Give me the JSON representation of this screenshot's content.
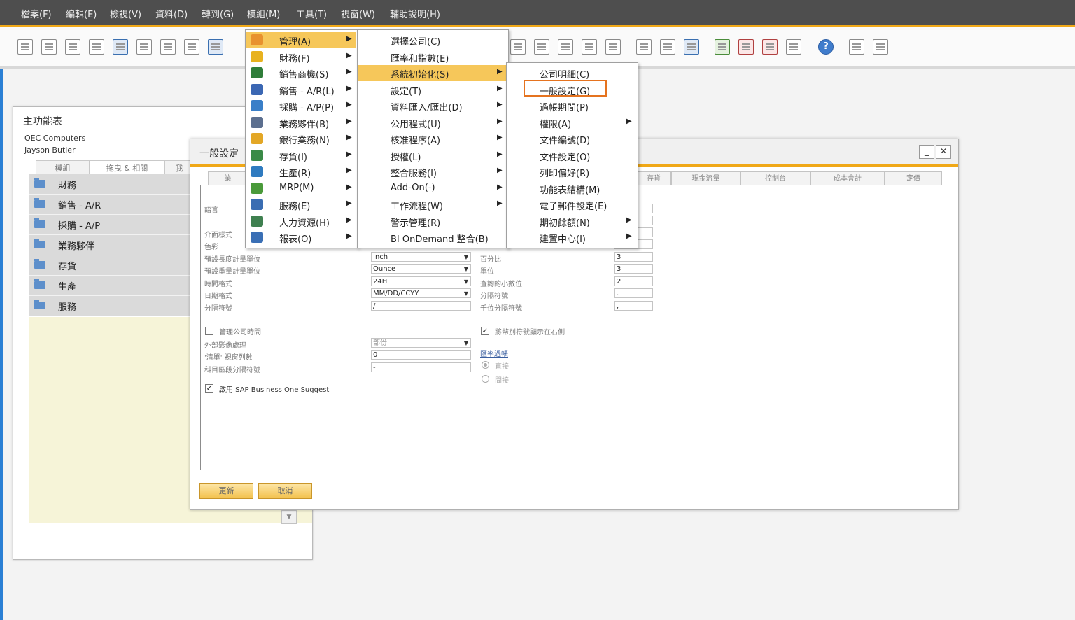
{
  "menubar": [
    "檔案(F)",
    "編輯(E)",
    "檢視(V)",
    "資料(D)",
    "轉到(G)",
    "模組(M)",
    "工具(T)",
    "視窗(W)",
    "輔助說明(H)"
  ],
  "toolbar": {
    "icons": [
      "preview-icon",
      "print-icon",
      "email-icon",
      "fax-icon",
      "sms-icon",
      "export-excel-icon",
      "export-word-icon",
      "export-pdf-icon",
      "move-icon",
      "help-icon"
    ],
    "help_label": "?"
  },
  "main_menu": {
    "title": "主功能表",
    "company": "OEC Computers",
    "user": "Jayson Butler",
    "tabs": [
      "模組",
      "拖曳 & 相關",
      "我"
    ],
    "items": [
      "財務",
      "銷售 - A/R",
      "採購 - A/P",
      "業務夥伴",
      "存貨",
      "生產",
      "服務"
    ],
    "scroll_glyph": "▼"
  },
  "general_settings": {
    "title": "一般設定",
    "minimize": "_",
    "close": "✕",
    "tabs_left": [
      "業"
    ],
    "tabs_right": [
      "存貨",
      "現金流量",
      "控制台",
      "成本會計",
      "定價"
    ],
    "left_fields": [
      {
        "label": "語言",
        "value": ""
      },
      {
        "label": "介面樣式",
        "value": ""
      },
      {
        "label": "色彩",
        "value": ""
      },
      {
        "label": "預設長度計量單位",
        "value": "Inch"
      },
      {
        "label": "預設重量計量單位",
        "value": "Ounce"
      },
      {
        "label": "時間格式",
        "value": "24H"
      },
      {
        "label": "日期格式",
        "value": "MM/DD/CCYY"
      },
      {
        "label": "分隔符號",
        "value": "/"
      }
    ],
    "right_fields": [
      {
        "label": "百分比",
        "value": "3"
      },
      {
        "label": "單位",
        "value": "3"
      },
      {
        "label": "查詢的小數位",
        "value": "2"
      },
      {
        "label": "分隔符號",
        "value": "."
      },
      {
        "label": "千位分隔符號",
        "value": ","
      }
    ],
    "manage_company_time": "管理公司時間",
    "external_image": {
      "label": "外部影像處理",
      "value": "部份"
    },
    "list_rows": {
      "label": "'清單' 視窗列數",
      "value": "0"
    },
    "account_sep": {
      "label": "科目區段分隔符號",
      "value": "-"
    },
    "suggest": "啟用 SAP Business One Suggest",
    "currency_right": "將幣別符號顯示在右側",
    "exchange_link": "匯率過帳",
    "radio_direct": "直接",
    "radio_indirect": "間接",
    "checked_glyph": "✓",
    "buttons": {
      "update": "更新",
      "cancel": "取消"
    }
  },
  "module_menu": {
    "items": [
      {
        "label": "管理(A)",
        "icon": "admin-icon",
        "color": "#e8912e",
        "selected": true
      },
      {
        "label": "財務(F)",
        "icon": "finance-icon",
        "color": "#e8b21f"
      },
      {
        "label": "銷售商機(S)",
        "icon": "opportunity-icon",
        "color": "#2f7d3a"
      },
      {
        "label": "銷售 - A/R(L)",
        "icon": "sales-icon",
        "color": "#3b67b3"
      },
      {
        "label": "採購 - A/P(P)",
        "icon": "cart-icon",
        "color": "#3a7fc8"
      },
      {
        "label": "業務夥伴(B)",
        "icon": "partners-icon",
        "color": "#5c6f8f"
      },
      {
        "label": "銀行業務(N)",
        "icon": "banking-icon",
        "color": "#e3a726"
      },
      {
        "label": "存貨(I)",
        "icon": "inventory-icon",
        "color": "#3a8a47"
      },
      {
        "label": "生產(R)",
        "icon": "production-icon",
        "color": "#2f7bc0"
      },
      {
        "label": "MRP(M)",
        "icon": "mrp-icon",
        "color": "#4a9a3a"
      },
      {
        "label": "服務(E)",
        "icon": "service-icon",
        "color": "#3a6db2"
      },
      {
        "label": "人力資源(H)",
        "icon": "hr-icon",
        "color": "#3f8050"
      },
      {
        "label": "報表(O)",
        "icon": "reports-icon",
        "color": "#3a6fb5"
      }
    ],
    "arrow": "▶"
  },
  "admin_menu": {
    "items": [
      {
        "label": "選擇公司(C)",
        "submenu": false
      },
      {
        "label": "匯率和指數(E)",
        "submenu": false
      },
      {
        "label": "系統初始化(S)",
        "submenu": true,
        "selected": true
      },
      {
        "label": "設定(T)",
        "submenu": true
      },
      {
        "label": "資料匯入/匯出(D)",
        "submenu": true
      },
      {
        "label": "公用程式(U)",
        "submenu": true
      },
      {
        "label": "核准程序(A)",
        "submenu": true
      },
      {
        "label": "授權(L)",
        "submenu": true
      },
      {
        "label": "整合服務(I)",
        "submenu": true
      },
      {
        "label": "Add-On(-)",
        "submenu": true
      },
      {
        "label": "工作流程(W)",
        "submenu": true
      },
      {
        "label": "警示管理(R)",
        "submenu": false
      },
      {
        "label": "BI OnDemand 整合(B)",
        "submenu": false
      }
    ]
  },
  "sysinit_menu": {
    "items": [
      {
        "label": "公司明細(C)",
        "submenu": false
      },
      {
        "label": "一般設定(G)",
        "submenu": false,
        "highlighted": true
      },
      {
        "label": "過帳期間(P)",
        "submenu": false
      },
      {
        "label": "權限(A)",
        "submenu": true
      },
      {
        "label": "文件編號(D)",
        "submenu": false
      },
      {
        "label": "文件設定(O)",
        "submenu": false
      },
      {
        "label": "列印偏好(R)",
        "submenu": false
      },
      {
        "label": "功能表結構(M)",
        "submenu": false
      },
      {
        "label": "電子郵件設定(E)",
        "submenu": false
      },
      {
        "label": "期初餘額(N)",
        "submenu": true
      },
      {
        "label": "建置中心(I)",
        "submenu": true
      }
    ]
  },
  "colors": {
    "accent": "#f0a817",
    "menu_selected": "#f6c75a",
    "highlight_box": "#e5731f",
    "menubar_bg": "#4e4e4e"
  }
}
